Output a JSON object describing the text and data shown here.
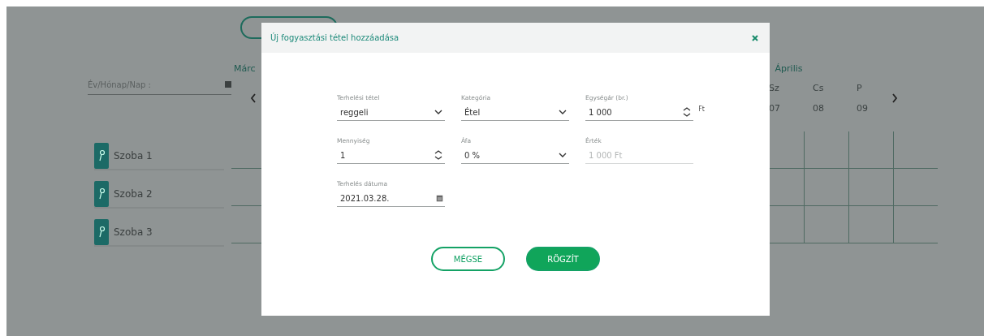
{
  "date_filter": {
    "placeholder": "Év/Hónap/Nap :"
  },
  "months": [
    "Márc",
    "Április"
  ],
  "days": [
    {
      "day": "Sz",
      "date": "07"
    },
    {
      "day": "Cs",
      "date": "08"
    },
    {
      "day": "P",
      "date": "09"
    }
  ],
  "rooms": [
    "Szoba 1",
    "Szoba 2",
    "Szoba 3"
  ],
  "dialog": {
    "title": "Új fogyasztási tétel hozzáadása",
    "fields": [
      {
        "kind": "select",
        "label": "Terhelési tétel",
        "value": "reggeli",
        "disabled": false
      },
      {
        "kind": "select",
        "label": "Kategória",
        "value": "Étel",
        "disabled": false
      },
      {
        "kind": "number",
        "label": "Egységár (br.)",
        "value": "1 000",
        "unit": "Ft",
        "disabled": false
      },
      {
        "kind": "number",
        "label": "Mennyiség",
        "value": "1",
        "disabled": false
      },
      {
        "kind": "select",
        "label": "Áfa",
        "value": "0 %",
        "disabled": false
      },
      {
        "kind": "text",
        "label": "Érték",
        "value": "1 000 Ft",
        "disabled": true
      },
      {
        "kind": "date",
        "label": "Terhelés dátuma",
        "value": "2021.03.28.",
        "disabled": false
      }
    ],
    "buttons": [
      {
        "kind": "secondary",
        "label": "MÉGSE"
      },
      {
        "kind": "primary",
        "label": "RÖGZÍT"
      }
    ]
  }
}
